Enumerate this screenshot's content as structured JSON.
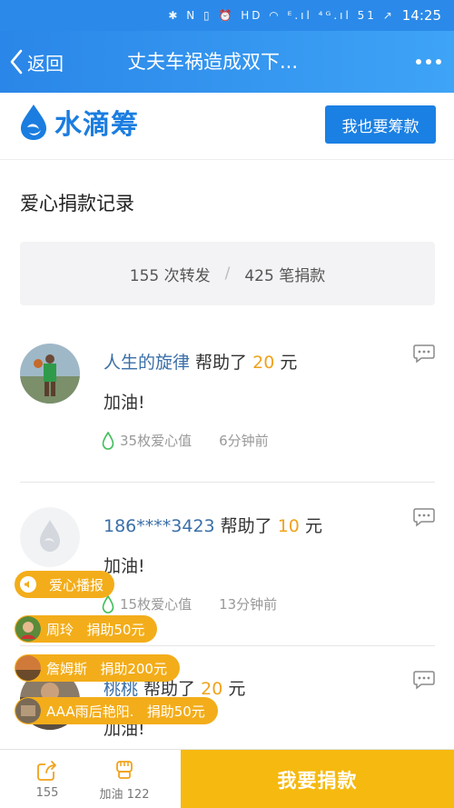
{
  "status_bar": {
    "icons": "✱ N ▯ ⏰ HD ◠ ᴱ.ıl ⁴ᴳ.ıl 51 ↗",
    "time": "14:25"
  },
  "nav": {
    "back_label": "返回",
    "title": "丈夫车祸造成双下..."
  },
  "brand": {
    "name": "水滴筹",
    "raise_button": "我也要筹款",
    "color": "#1b7de0"
  },
  "section_title": "爱心捐款记录",
  "stats": {
    "forwards": "155 次转发",
    "donations": "425 笔捐款"
  },
  "records": [
    {
      "donor": "人生的旋律",
      "helped": " 帮助了 ",
      "amount": "20",
      "unit": " 元",
      "message": "加油!",
      "points": "35枚爱心值",
      "time": "6分钟前"
    },
    {
      "donor": "186****3423",
      "helped": " 帮助了 ",
      "amount": "10",
      "unit": " 元",
      "message": "加油!",
      "points": "15枚爱心值",
      "time": "13分钟前"
    },
    {
      "donor": "桃桃",
      "helped": " 帮助了 ",
      "amount": "20",
      "unit": " 元",
      "message": "加油!"
    }
  ],
  "broadcast": {
    "label": "爱心播报",
    "items": [
      {
        "name": "周玲",
        "action": "捐助50元"
      },
      {
        "name": "詹姆斯",
        "action": "捐助200元"
      },
      {
        "name": "AAA雨后艳阳.",
        "action": "捐助50元"
      }
    ]
  },
  "bottom_bar": {
    "share_count": "155",
    "cheer_label": "加油 122",
    "donate_label": "我要捐款",
    "accent": "#f6b90f"
  }
}
